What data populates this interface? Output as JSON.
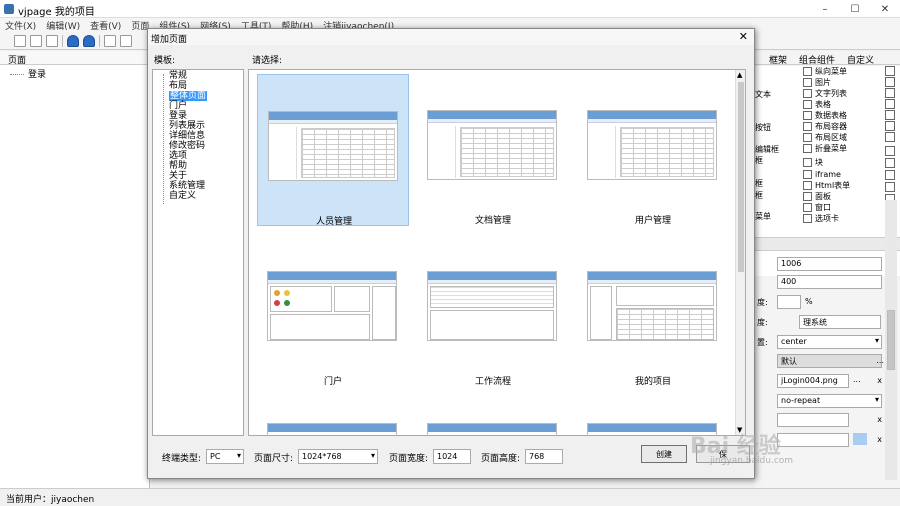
{
  "window": {
    "title": "vjpage 我的项目"
  },
  "menu": [
    "文件(X)",
    "编辑(W)",
    "查看(V)",
    "页面",
    "组件(S)",
    "网络(S)",
    "工具(T)",
    "帮助(H)",
    "注销jiyaochen(J)"
  ],
  "left_panel": {
    "header": "页面",
    "items": [
      "登录"
    ]
  },
  "status": {
    "current_user": "当前用户：jiyaochen"
  },
  "right_panel": {
    "tabs": [
      "框架",
      "组合组件",
      "自定义"
    ],
    "components": [
      "纵向菜单",
      "图片",
      "文字列表",
      "表格",
      "数据表格",
      "布局容器",
      "布局区域",
      "折叠菜单",
      "块",
      "iframe",
      "Html表单",
      "面板",
      "窗口",
      "选项卡"
    ],
    "fragments_left": [
      "文本",
      "按钮",
      "编辑框",
      "框",
      "框",
      "框",
      "菜单"
    ],
    "props": {
      "width": "1006",
      "height": "400",
      "pct": "%",
      "title_frag": "理系统",
      "align": "center",
      "default": "默认",
      "bg_image": "jLogin004.png",
      "repeat": "no-repeat",
      "label_du1": "度:",
      "label_du2": "度:",
      "label_zhi": "置:",
      "dots": "...",
      "x": "x"
    }
  },
  "dialog": {
    "title": "增加页面",
    "template_label": "模板:",
    "select_label": "请选择:",
    "templates": [
      "常规",
      "布局",
      "整体页面",
      "门户",
      "登录",
      "列表展示",
      "详细信息",
      "修改密码",
      "选项",
      "帮助",
      "关于",
      "系统管理",
      "自定义"
    ],
    "selected_template": "整体页面",
    "cards": [
      "人员管理",
      "文档管理",
      "用户管理",
      "门户",
      "工作流程",
      "我的项目"
    ],
    "bottom": {
      "device_label": "终端类型:",
      "device_value": "PC",
      "size_label": "页面尺寸:",
      "size_value": "1024*768",
      "width_label": "页面宽度:",
      "width_value": "1024",
      "height_label": "页面高度:",
      "height_value": "768",
      "create": "创建",
      "cancel": "保"
    }
  },
  "watermark": {
    "main": "Bai 经验",
    "sub": "jingyan.baidu.com"
  }
}
